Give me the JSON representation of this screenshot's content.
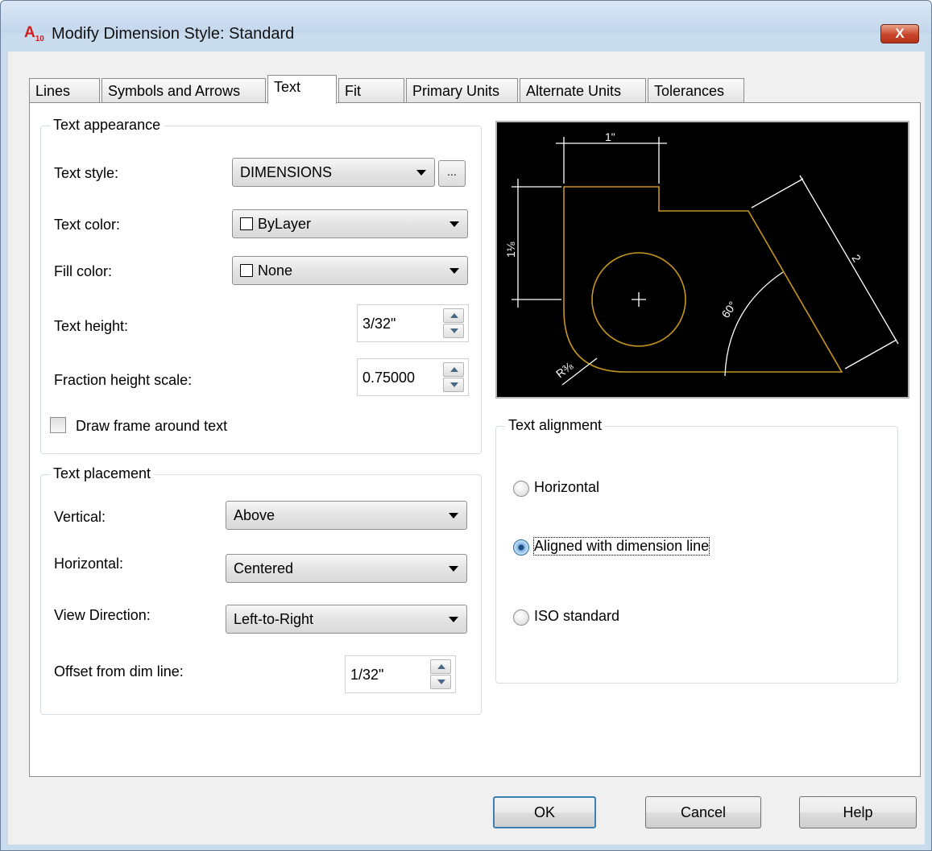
{
  "window": {
    "title": "Modify Dimension Style: Standard",
    "close_label": "X"
  },
  "tabs": [
    {
      "label": "Lines",
      "active": false
    },
    {
      "label": "Symbols and Arrows",
      "active": false
    },
    {
      "label": "Text",
      "active": true
    },
    {
      "label": "Fit",
      "active": false
    },
    {
      "label": "Primary Units",
      "active": false
    },
    {
      "label": "Alternate Units",
      "active": false
    },
    {
      "label": "Tolerances",
      "active": false
    }
  ],
  "text_appearance": {
    "title": "Text appearance",
    "text_style": {
      "label": "Text style:",
      "value": "DIMENSIONS",
      "browse_label": "..."
    },
    "text_color": {
      "label": "Text color:",
      "value": "ByLayer"
    },
    "fill_color": {
      "label": "Fill color:",
      "value": "None"
    },
    "text_height": {
      "label": "Text height:",
      "value": "3/32\""
    },
    "fraction_height_scale": {
      "label": "Fraction height scale:",
      "value": "0.75000"
    },
    "draw_frame": {
      "label": "Draw frame around text",
      "checked": false
    }
  },
  "text_placement": {
    "title": "Text placement",
    "vertical": {
      "label": "Vertical:",
      "value": "Above"
    },
    "horizontal": {
      "label": "Horizontal:",
      "value": "Centered"
    },
    "view_direction": {
      "label": "View Direction:",
      "value": "Left-to-Right"
    },
    "offset": {
      "label": "Offset from dim line:",
      "value": "1/32\""
    }
  },
  "preview": {
    "dim_top": "1\"",
    "dim_left": "1⅛",
    "dim_slant": "2",
    "dim_angle": "60°",
    "dim_radius": "R⅜",
    "colors": {
      "background": "#000000",
      "geometry": "#c8961e",
      "dimensions": "#ffffff"
    }
  },
  "text_alignment": {
    "title": "Text alignment",
    "options": [
      {
        "label": "Horizontal",
        "checked": false
      },
      {
        "label": "Aligned with dimension line",
        "checked": true
      },
      {
        "label": "ISO standard",
        "checked": false
      }
    ]
  },
  "buttons": {
    "ok": "OK",
    "cancel": "Cancel",
    "help": "Help"
  }
}
